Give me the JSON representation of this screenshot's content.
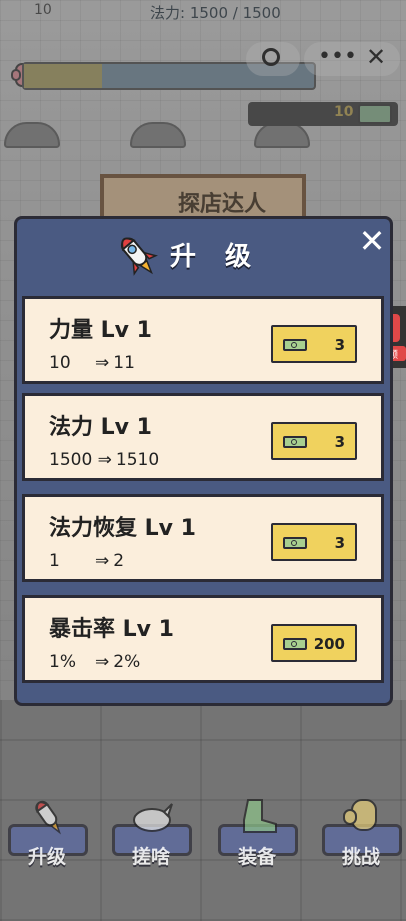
{
  "hud": {
    "level_num": "10",
    "mp_text": "法力: 1500 / 1500",
    "money": "10"
  },
  "background": {
    "shop_sign": "探店达人"
  },
  "modal": {
    "title": "升 级",
    "close_label": "✕",
    "items": [
      {
        "title": "力量 Lv  1",
        "from": "10",
        "to": "11",
        "price": "3"
      },
      {
        "title": "法力 Lv  1",
        "from": "1500",
        "to": "1510",
        "price": "3"
      },
      {
        "title": "法力恢复 Lv  1",
        "from": "1",
        "to": "2",
        "price": "3"
      },
      {
        "title": "暴击率 Lv  1",
        "from": "1%",
        "to": "2%",
        "price": "200"
      }
    ],
    "arrow": "⇒"
  },
  "side_badge": {
    "label": "免费领"
  },
  "nav": [
    {
      "label": "升级",
      "icon": "rocket-icon"
    },
    {
      "label": "搓啥",
      "icon": "rhino-icon"
    },
    {
      "label": "装备",
      "icon": "boot-icon"
    },
    {
      "label": "挑战",
      "icon": "glove-icon"
    }
  ],
  "colors": {
    "modal_bg": "#4a5a82",
    "card_bg": "#fbeedc",
    "buy_button": "#f0d25e"
  }
}
